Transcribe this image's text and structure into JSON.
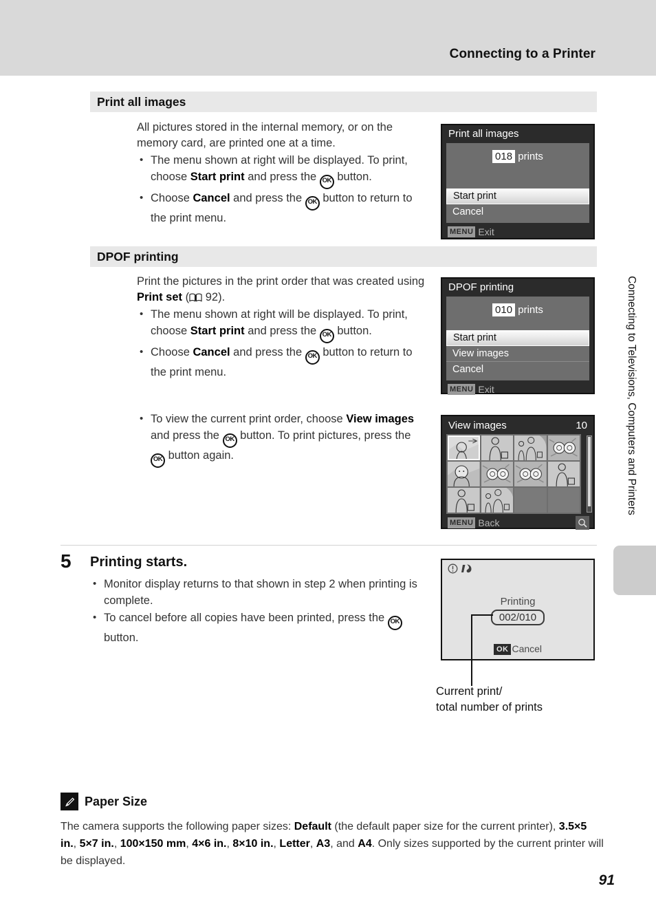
{
  "header": {
    "title": "Connecting to a Printer"
  },
  "side_rail": {
    "vertical_text": "Connecting to Televisions, Computers and Printers"
  },
  "sections": {
    "print_all_images": {
      "heading": "Print all images",
      "lead": "All pictures stored in the internal memory, or on the memory card, are printed one at a time.",
      "bullets": [
        {
          "pre": "The menu shown at right will be displayed. To print, choose ",
          "bold": "Start print",
          "mid": " and press the ",
          "icon": "ok-button-icon",
          "post": " button."
        },
        {
          "pre": "Choose ",
          "bold": "Cancel",
          "mid": " and press the ",
          "icon": "ok-button-icon",
          "post": " button to return to the print menu."
        }
      ]
    },
    "dpof_printing": {
      "heading": "DPOF printing",
      "lead_pre": "Print the pictures in the print order that was created using ",
      "lead_bold": "Print set",
      "lead_ref_open": " (",
      "lead_ref_page": "92",
      "lead_ref_close": ").",
      "bullets": [
        {
          "pre": "The menu shown at right will be displayed. To print, choose ",
          "bold": "Start print",
          "mid": " and press the ",
          "icon": "ok-button-icon",
          "post": " button."
        },
        {
          "pre": "Choose ",
          "bold": "Cancel",
          "mid": " and press the ",
          "icon": "ok-button-icon",
          "post": " button to return to the print menu."
        }
      ],
      "view_bullet": {
        "pre": "To view the current print order, choose ",
        "bold": "View images",
        "mid": " and press the ",
        "icon": "ok-button-icon",
        "post": " button. To print pictures, press the ",
        "post2": " button again."
      }
    }
  },
  "monitors": {
    "print_all": {
      "title": "Print all images",
      "count": "018",
      "count_label": "prints",
      "items": [
        {
          "label": "Start print",
          "selected": true
        },
        {
          "label": "Cancel",
          "selected": false
        }
      ],
      "footer_badge": "MENU",
      "footer_label": "Exit"
    },
    "dpof": {
      "title": "DPOF printing",
      "count": "010",
      "count_label": "prints",
      "items": [
        {
          "label": "Start print",
          "selected": true
        },
        {
          "label": "View images",
          "selected": false
        },
        {
          "label": "Cancel",
          "selected": false
        }
      ],
      "footer_badge": "MENU",
      "footer_label": "Exit"
    },
    "view_images": {
      "title": "View images",
      "count": "10",
      "footer_badge": "MENU",
      "footer_label": "Back",
      "magnifier_icon": "magnifier-icon",
      "thumbnails": [
        {
          "kind": "portrait-landscape",
          "selected": true
        },
        {
          "kind": "person-bag",
          "selected": false
        },
        {
          "kind": "two-people",
          "selected": false
        },
        {
          "kind": "flowers",
          "selected": false
        },
        {
          "kind": "portrait-closeup",
          "selected": false
        },
        {
          "kind": "flowers",
          "selected": false
        },
        {
          "kind": "flowers",
          "selected": false
        },
        {
          "kind": "person-bag",
          "selected": false
        },
        {
          "kind": "person-bag",
          "selected": false
        },
        {
          "kind": "two-people",
          "selected": false
        },
        {
          "kind": "empty",
          "selected": false
        },
        {
          "kind": "empty",
          "selected": false
        }
      ]
    },
    "printing": {
      "status_icons": [
        "warning-circle-icon",
        "motion-blur-icon"
      ],
      "label": "Printing",
      "count": "002/010",
      "footer_badge": "OK",
      "footer_label": "Cancel",
      "caption_line1": "Current print/",
      "caption_line2": "total number of prints"
    }
  },
  "step5": {
    "number": "5",
    "title": "Printing starts.",
    "bullets": [
      {
        "text": "Monitor display returns to that shown in step 2 when printing is complete."
      },
      {
        "pre": "To cancel before all copies have been printed, press the ",
        "icon": "ok-button-icon",
        "post": " button."
      }
    ]
  },
  "note": {
    "icon": "pencil-note-icon",
    "title": "Paper Size",
    "body_pre": "The camera supports the following paper sizes: ",
    "default_bold": "Default",
    "body_mid": " (the default paper size for the current printer), ",
    "sizes": [
      "3.5×5 in.",
      "5×7 in.",
      "100×150 mm",
      "4×6 in.",
      "8×10 in.",
      "Letter",
      "A3",
      "A4"
    ],
    "body_post": ". Only sizes supported by the current printer will be displayed.",
    "and_word": "and"
  },
  "page_number": "91"
}
